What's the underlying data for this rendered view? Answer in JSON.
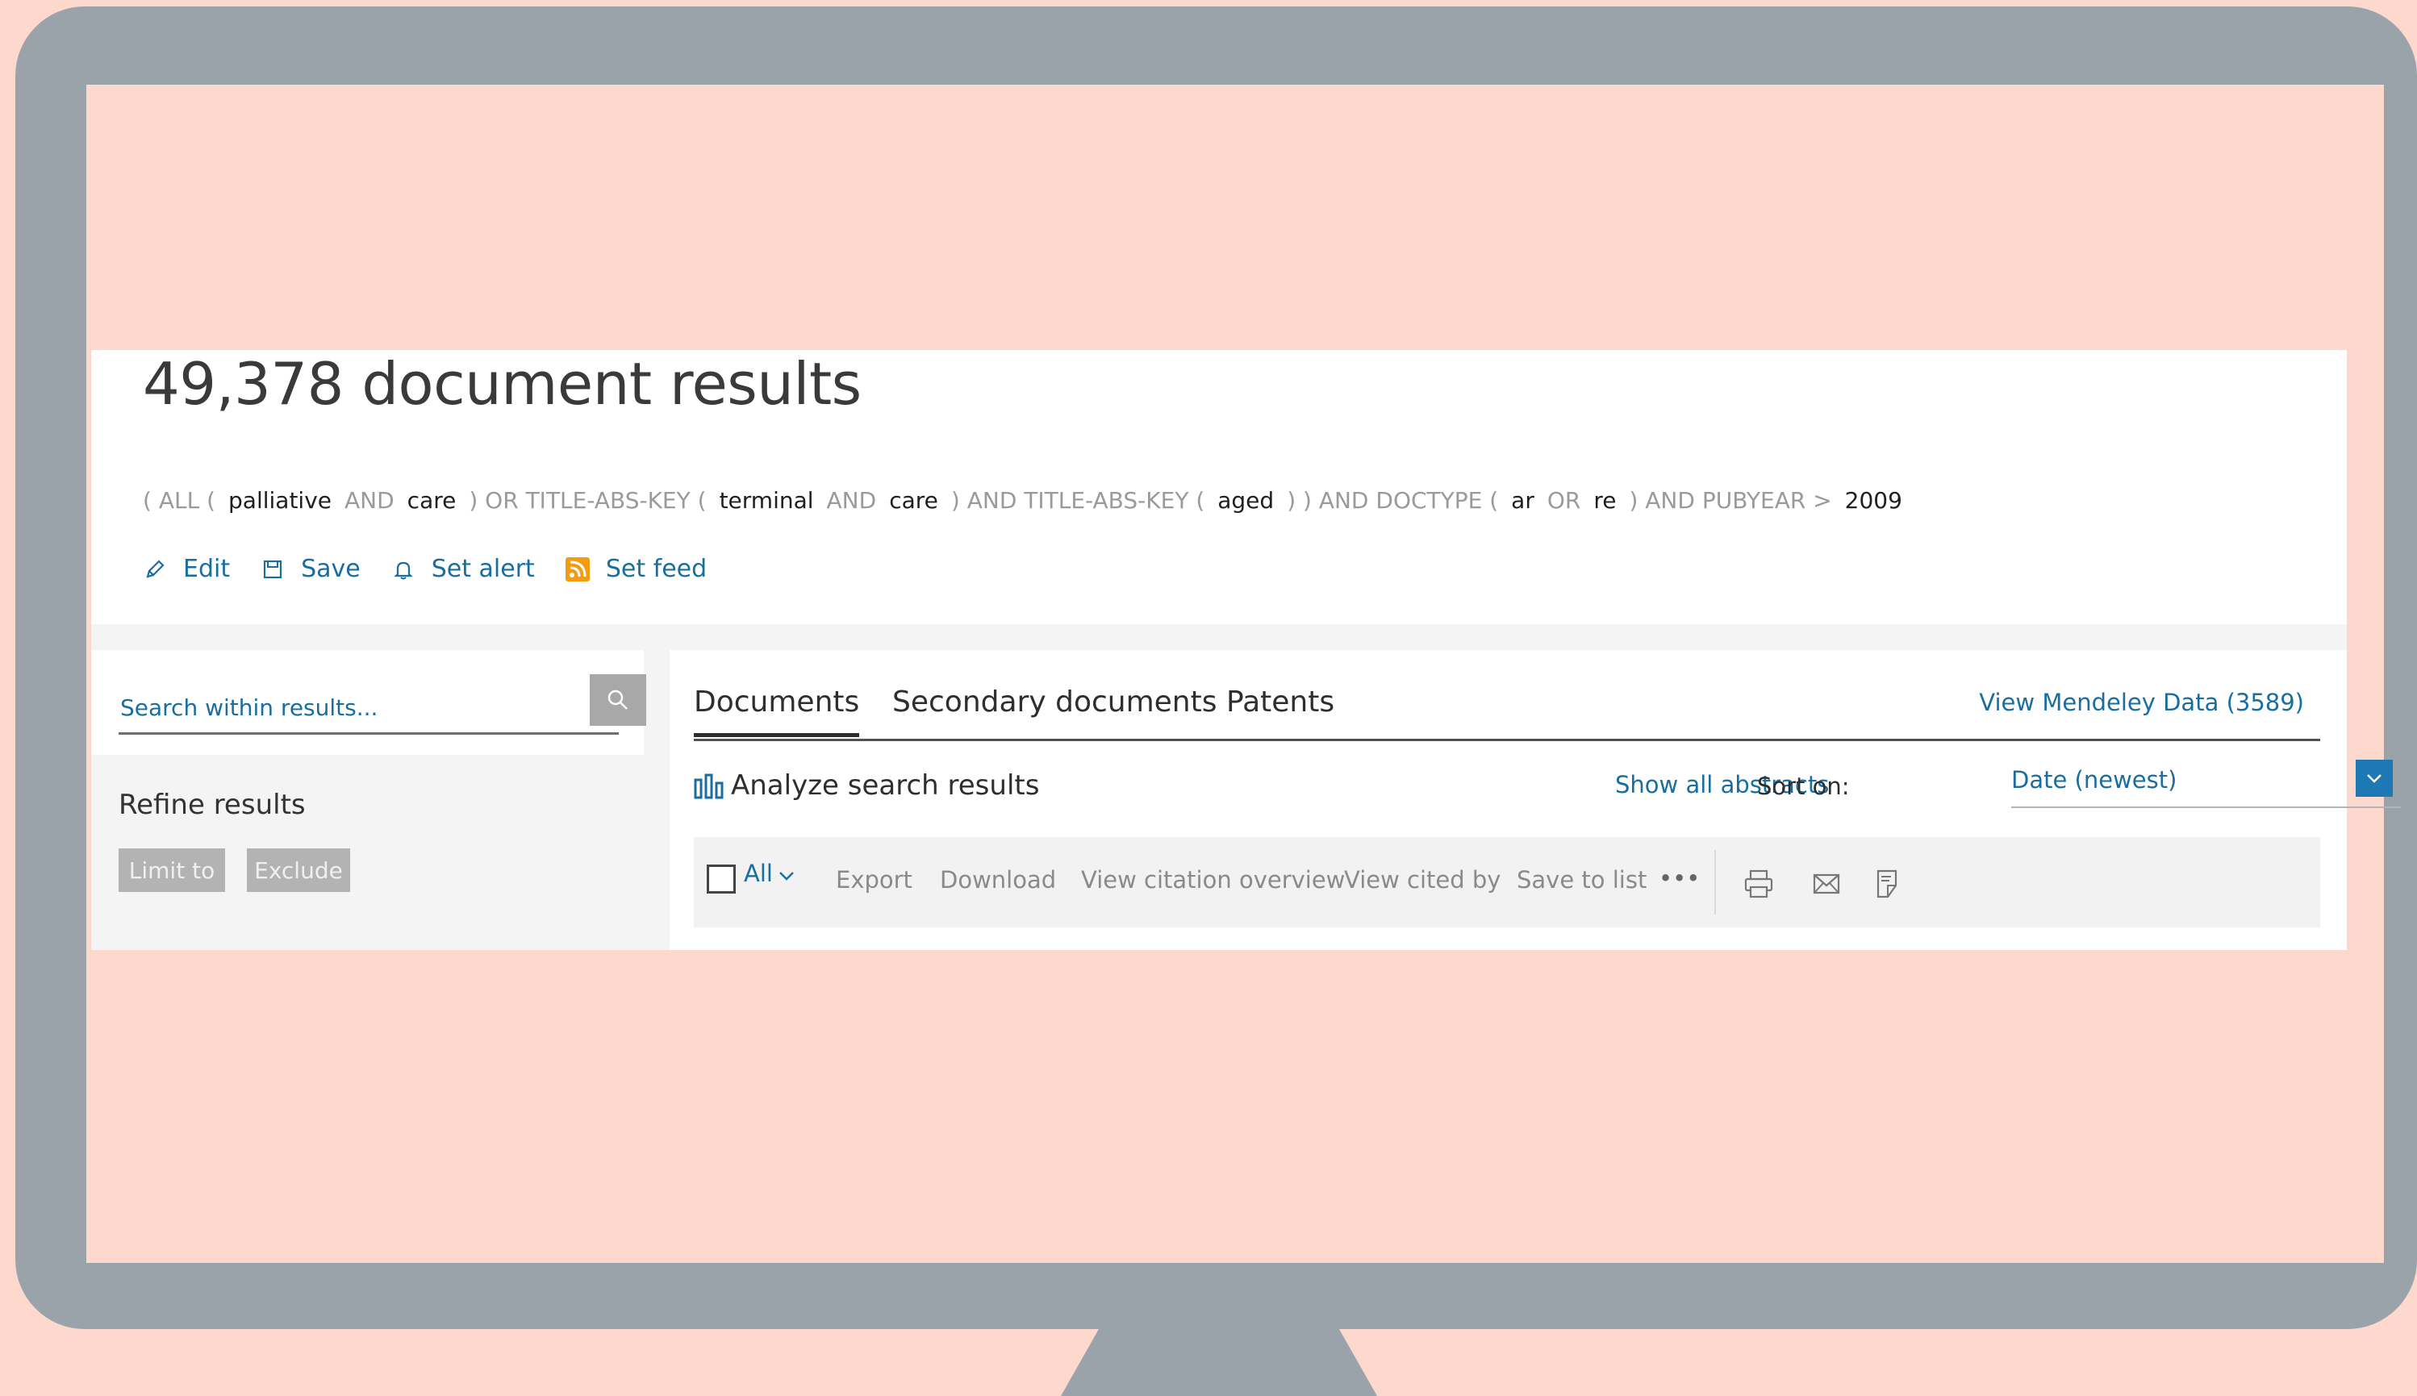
{
  "results": {
    "title": "49,378 document results"
  },
  "query": {
    "tokens": [
      {
        "text": "( ALL (",
        "kind": "op"
      },
      {
        "text": "palliative",
        "kind": "term"
      },
      {
        "text": "AND",
        "kind": "op"
      },
      {
        "text": "care",
        "kind": "term"
      },
      {
        "text": ")  OR  TITLE-ABS-KEY (",
        "kind": "op"
      },
      {
        "text": "terminal",
        "kind": "term"
      },
      {
        "text": "AND",
        "kind": "op"
      },
      {
        "text": "care",
        "kind": "term"
      },
      {
        "text": ")  AND  TITLE-ABS-KEY (",
        "kind": "op"
      },
      {
        "text": "aged",
        "kind": "term"
      },
      {
        "text": ") )  AND  DOCTYPE (",
        "kind": "op"
      },
      {
        "text": "ar",
        "kind": "term"
      },
      {
        "text": "OR",
        "kind": "op"
      },
      {
        "text": "re",
        "kind": "term"
      },
      {
        "text": ")  AND  PUBYEAR  >",
        "kind": "op"
      },
      {
        "text": "2009",
        "kind": "term"
      }
    ]
  },
  "actions": {
    "edit": "Edit",
    "save": "Save",
    "set_alert": "Set alert",
    "set_feed": "Set feed"
  },
  "sidebar": {
    "search_placeholder": "Search within results...",
    "refine_title": "Refine results",
    "limit_to": "Limit to",
    "exclude": "Exclude"
  },
  "tabs": {
    "documents": "Documents",
    "secondary": "Secondary documents",
    "patents": "Patents",
    "mendeley": "View Mendeley Data (3589)"
  },
  "controls": {
    "analyze": "Analyze search results",
    "show_abstracts": "Show all abstracts",
    "sort_label": "Sort on:",
    "sort_value": "Date (newest)"
  },
  "toolbar": {
    "all": "All",
    "export": "Export",
    "download": "Download",
    "citation_overview": "View citation overview",
    "cited_by": "View cited by",
    "save_to_list": "Save to list",
    "more": "•••"
  },
  "colors": {
    "background": "#fcd8cd",
    "monitor": "#9aa3a9",
    "link": "#1a6e9f",
    "feed_icon": "#f39c12"
  }
}
